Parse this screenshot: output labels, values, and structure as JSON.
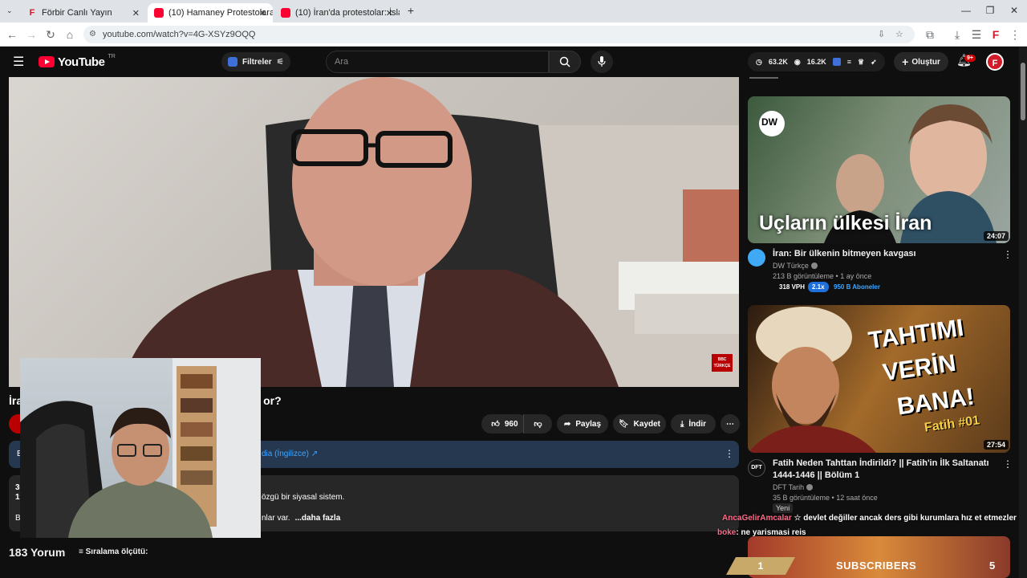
{
  "browser": {
    "tabs": [
      {
        "title": "Förbir Canlı Yayın",
        "favicon": "forbir-icon"
      },
      {
        "title": "(10) Hamaney Protestolara Day",
        "favicon": "youtube-icon"
      },
      {
        "title": "(10) İran'da protestolar: İslam C",
        "favicon": "youtube-icon"
      }
    ],
    "url": "youtube.com/watch?v=4G-XSYz9OQQ"
  },
  "header": {
    "logo_text": "YouTube",
    "country": "TR",
    "filters_label": "Filtreler",
    "search_placeholder": "Ara",
    "stat_views": "63.2K",
    "stat_watch": "16.2K",
    "create_label": "Oluştur",
    "notif_badge": "9+",
    "avatar_letter": "F"
  },
  "video": {
    "title": "İra",
    "title_end": "or?",
    "overlay_logo": "BBC\nTÜRKÇE",
    "like_count": "960",
    "share_label": "Paylaş",
    "save_label": "Kaydet",
    "download_label": "İndir",
    "info_prefix": "B",
    "info_link": "dia (İngilizce) ↗",
    "desc_prefix_1": "30",
    "desc_prefix_2": "19",
    "desc_text": "özgü bir siyasal sistem.",
    "desc_prefix_3": "B",
    "desc_tail": "nlar var.",
    "desc_more": "...daha fazla",
    "comments": "183 Yorum",
    "sort_label": "Sıralama ölçütü:"
  },
  "sidebar": {
    "items": [
      {
        "thumb_text": "Uçların ülkesi İran",
        "thumb_brand": "DW",
        "duration": "24:07",
        "title": "İran: Bir ülkenin bitmeyen kavgası",
        "channel": "DW Türkçe",
        "meta": "213 B görüntüleme • 1 ay önce",
        "vph": "318 VPH",
        "multiplier": "2.1x",
        "subs": "950 B Aboneler"
      },
      {
        "thumb_text_1": "TAHTIMI",
        "thumb_text_2": "VERİN",
        "thumb_text_3": "BANA!",
        "thumb_sub": "Fatih #01",
        "duration": "27:54",
        "title": "Fatih Neden Tahttan İndirildi? || Fatih'in İlk Saltanatı 1444-1446 || Bölüm 1",
        "channel": "DFT Tarih",
        "channel_badge": "DFT",
        "meta": "35 B görüntüleme • 12 saat önce",
        "badge": "Yeni"
      }
    ]
  },
  "chat": {
    "line1_name": "AncaGelirAmcalar",
    "line1_text": "devlet değiller ancak ders gibi kurumlara hız et etmezler",
    "line2_name": "boke",
    "line2_text": ": ne yarismasi reis"
  },
  "subscribers": {
    "left_value": "1",
    "label": "SUBSCRIBERS",
    "count": "5"
  },
  "colors": {
    "accent_red": "#ff0033",
    "info_banner": "#263850",
    "link_blue": "#3ea6ff"
  }
}
